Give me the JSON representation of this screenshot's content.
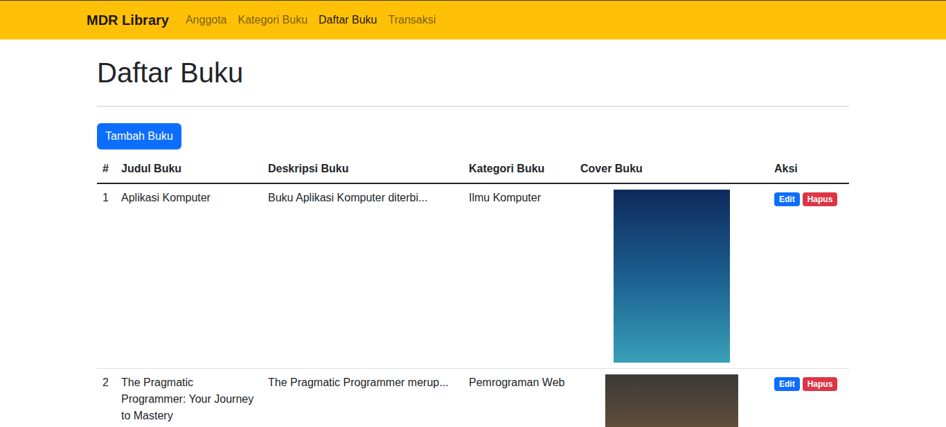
{
  "navbar": {
    "brand": "MDR Library",
    "items": [
      {
        "label": "Anggota",
        "selected": false
      },
      {
        "label": "Kategori Buku",
        "selected": false
      },
      {
        "label": "Daftar Buku",
        "selected": true
      },
      {
        "label": "Transaksi",
        "selected": false
      }
    ]
  },
  "page": {
    "title": "Daftar Buku",
    "add_button": "Tambah Buku"
  },
  "table": {
    "columns": [
      "#",
      "Judul Buku",
      "Deskripsi Buku",
      "Kategori Buku",
      "Cover Buku",
      "Aksi"
    ],
    "rows": [
      {
        "number": "1",
        "title": "Aplikasi Komputer",
        "description": "Buku Aplikasi Komputer diterbi...",
        "category": "Ilmu Komputer",
        "actions": [
          "Edit",
          "Hapus"
        ]
      },
      {
        "number": "2",
        "title": "The Pragmatic Programmer: Your Journey to Mastery",
        "description": "The Pragmatic Programmer merup...",
        "category": "Pemrograman Web",
        "actions": [
          "Edit",
          "Hapus"
        ]
      }
    ]
  }
}
